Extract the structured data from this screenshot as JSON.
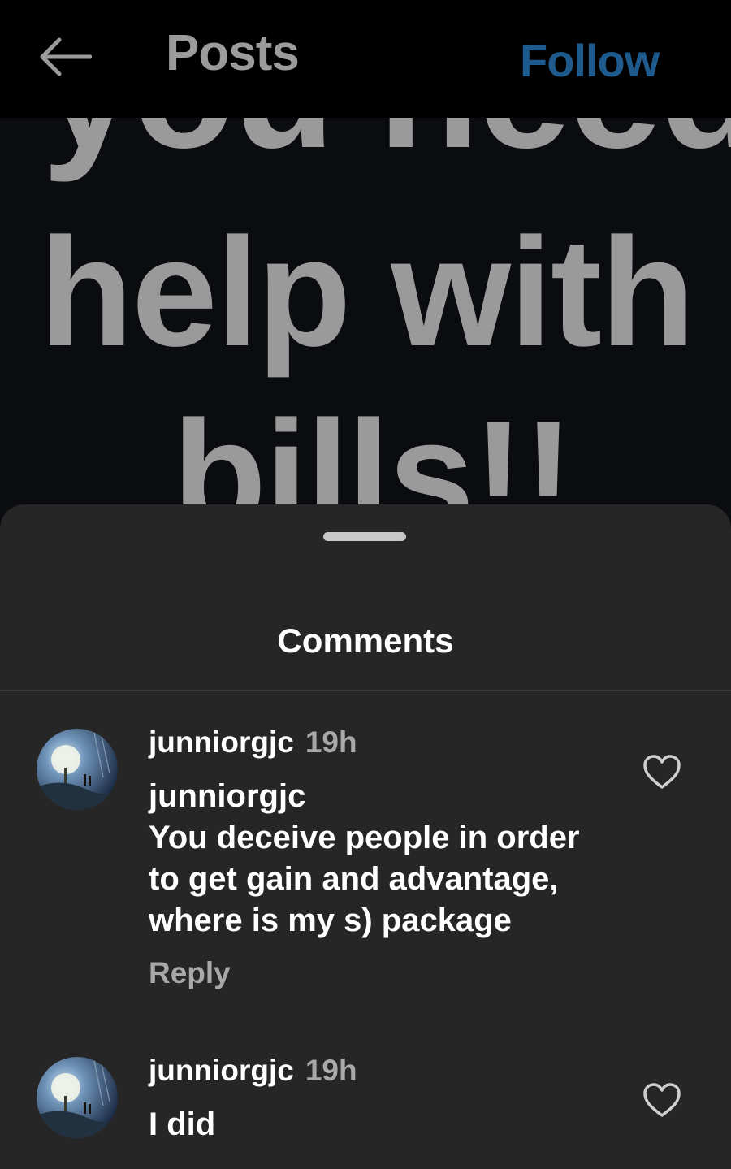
{
  "topbar": {
    "title": "Posts",
    "follow_label": "Follow",
    "back_icon": "arrow-left-icon"
  },
  "post": {
    "lines": [
      "you need",
      "help with",
      "bills!!"
    ]
  },
  "comments_sheet": {
    "title": "Comments",
    "comments": [
      {
        "username": "junniorgjc",
        "time": "19h",
        "text_lines": [
          "junniorgjc",
          "You deceive people in order",
          "to get gain and advantage,",
          "where is my s) package"
        ],
        "reply_label": "Reply"
      },
      {
        "username": "junniorgjc",
        "time": "19h",
        "text_lines": [
          "I did"
        ]
      }
    ]
  },
  "colors": {
    "background": "#000000",
    "sheet": "#262626",
    "follow": "#1e5a8c",
    "muted": "#a8a8a8"
  }
}
